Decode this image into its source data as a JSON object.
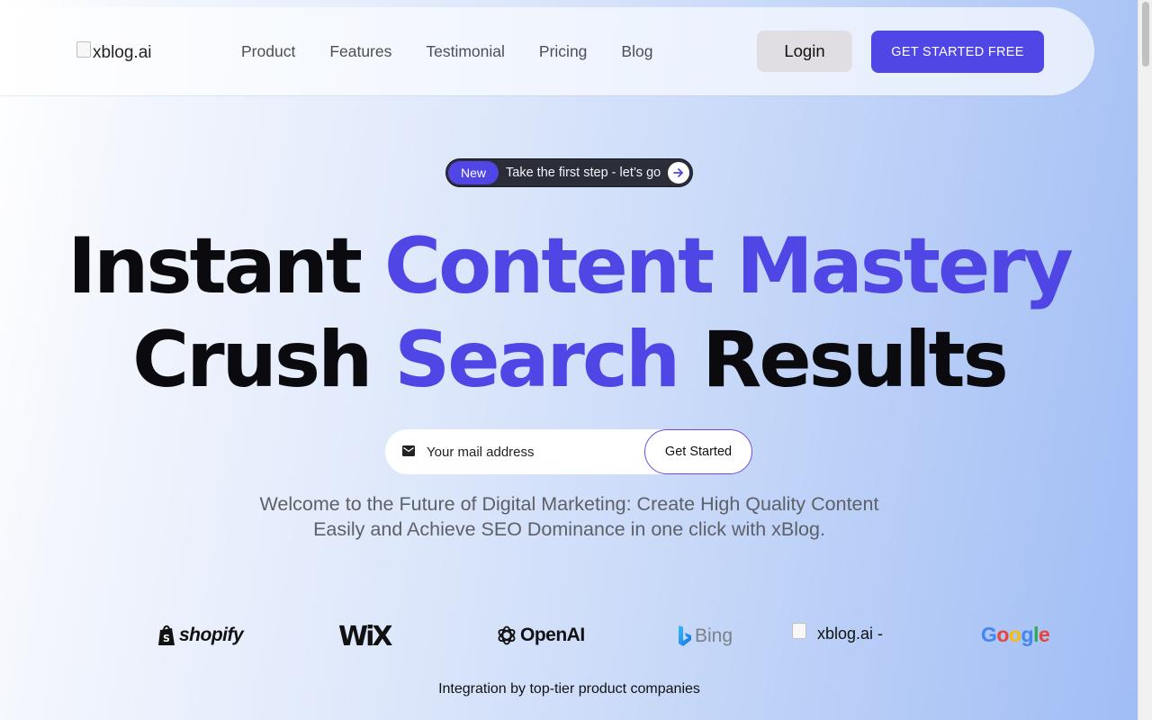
{
  "nav": {
    "logo_alt": "xblog.ai",
    "links": [
      "Product",
      "Features",
      "Testimonial",
      "Pricing",
      "Blog"
    ],
    "login_label": "Login",
    "cta_label": "GET STARTED FREE"
  },
  "badge": {
    "tag": "New",
    "text": "Take the first step - let’s go"
  },
  "hero": {
    "line1_plain": "Instant ",
    "line1_accent": "Content Mastery",
    "line2_plain_start": "Crush ",
    "line2_accent": "Search",
    "line2_plain_end": " Results",
    "accent_color": "#4f46e5"
  },
  "signup": {
    "email_placeholder": "Your mail address",
    "submit_label": "Get Started"
  },
  "subtitle": {
    "line1": "Welcome to the Future of Digital Marketing: Create High Quality Content",
    "line2": "Easily and Achieve SEO Dominance in one click with xBlog."
  },
  "integrations": {
    "logos": {
      "shopify": "shopify",
      "wix": "WiX",
      "openai": "OpenAI",
      "bing": "Bing",
      "xblog": "xblog.ai -",
      "google": "Google"
    },
    "caption": "Integration by top-tier product companies"
  }
}
